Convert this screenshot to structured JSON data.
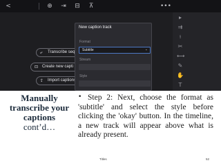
{
  "dialog": {
    "title": "New caption track",
    "format_label": "Format",
    "format_value": "Subtitle",
    "stream_label": "Stream",
    "style_label": "Style"
  },
  "left_panel": {
    "buttons": [
      {
        "label": "Transcribe sequ",
        "icon": "transcribe-icon"
      },
      {
        "label": "Create new capti",
        "icon": "cc-icon"
      },
      {
        "label": "Import captions fr",
        "icon": "import-icon"
      }
    ]
  },
  "slide": {
    "title_bold_line1": "Manually",
    "title_bold_line2": "transcribe your",
    "title_bold_line3": "captions",
    "title_normal": "cont’d…",
    "bullet": "•",
    "body": "Step 2: Next, choose the format as 'subtitle' and select the style before clicking the 'okay' button. In the timeline, a new track will appear above what is already present.",
    "footer_center": "Titles",
    "page_number": "52"
  },
  "colors": {
    "panel_bg": "#1c1c1f",
    "dialog_bg": "#2b2b30",
    "select_border": "#4d79c7",
    "title_text": "#1b2a3a"
  }
}
